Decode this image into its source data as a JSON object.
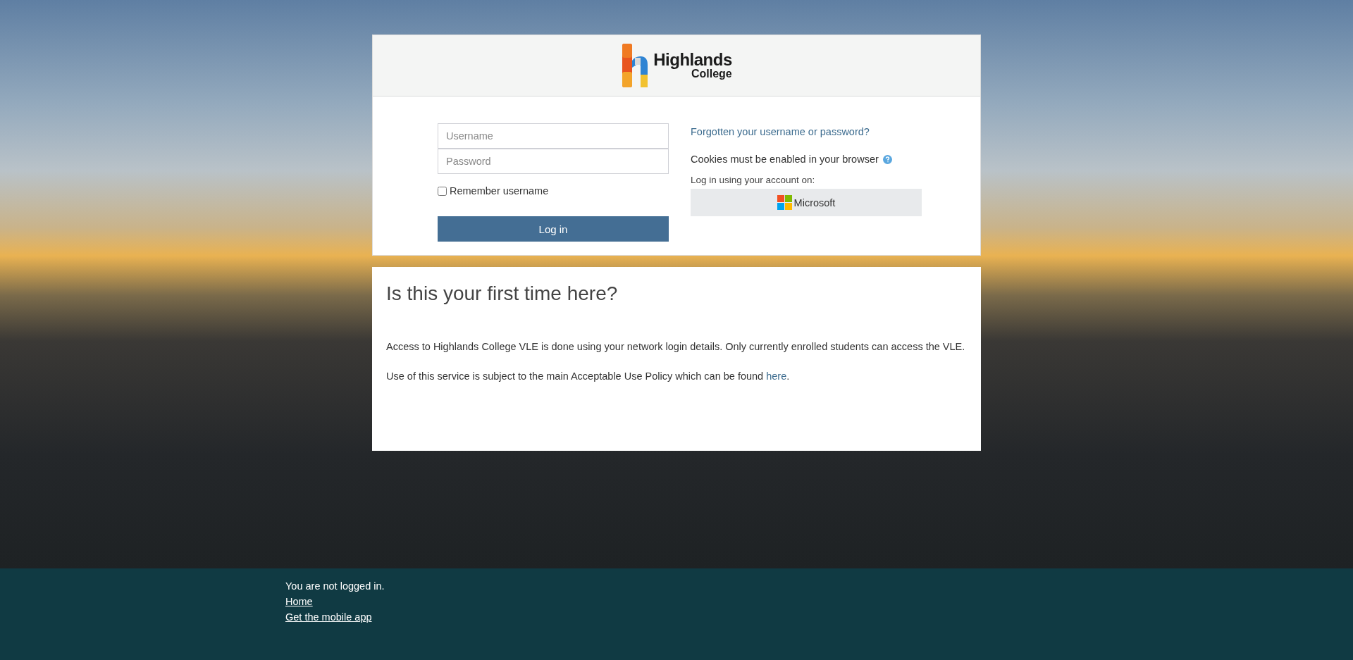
{
  "logo": {
    "line1": "Highlands",
    "line2": "College"
  },
  "login": {
    "username": {
      "placeholder": "Username"
    },
    "password": {
      "placeholder": "Password"
    },
    "remember": {
      "label": "Remember username",
      "checked": false
    },
    "button": "Log in",
    "forgot_link": "Forgotten your username or password?",
    "cookies_notice": "Cookies must be enabled in your browser",
    "sso_label": "Log in using your account on:",
    "sso_button": "Microsoft"
  },
  "first_time": {
    "heading": "Is this your first time here?",
    "paragraph1": "Access to Highlands College VLE is done using your network login details. Only currently enrolled students can access the VLE.",
    "paragraph2": {
      "before": "Use of this service is subject to the main Acceptable Use Policy which can be found ",
      "link": "here",
      "after": "."
    }
  },
  "footer": {
    "status": "You are not logged in.",
    "links": [
      "Home",
      "Get the mobile app"
    ]
  }
}
